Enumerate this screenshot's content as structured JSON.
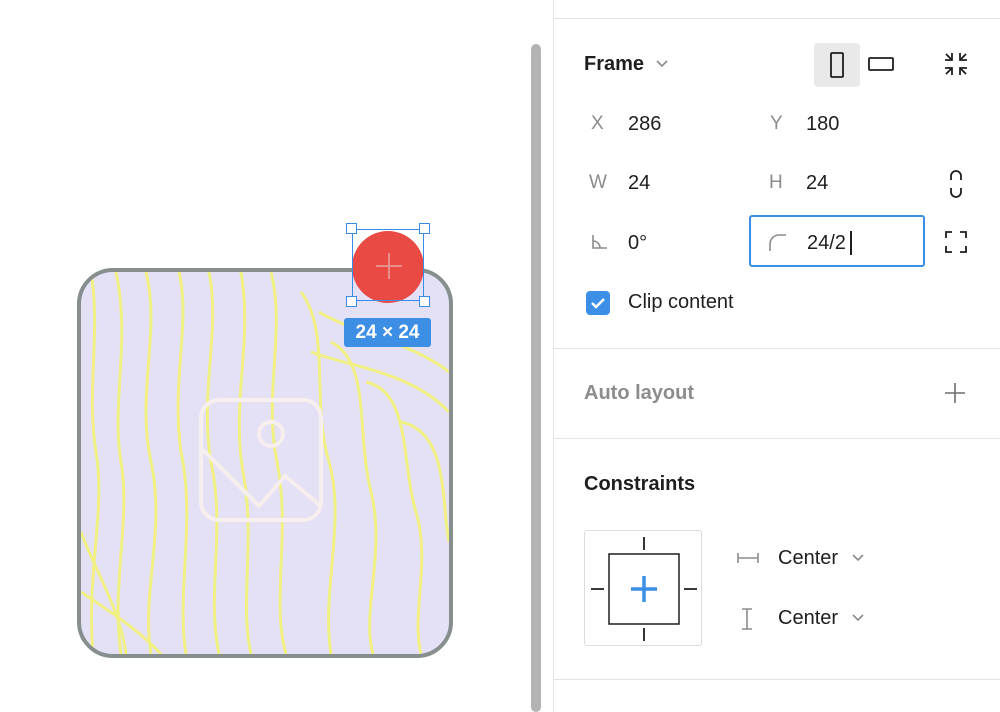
{
  "canvas": {
    "selection_size_label": "24 × 24",
    "colors": {
      "card_fill": "#e4e0f6",
      "card_stroke": "#868f8e",
      "topo_lines": "#f1f082",
      "ellipse": "#ea4a44",
      "selection": "#3a8de6"
    }
  },
  "panel": {
    "frame": {
      "title": "Frame",
      "x_label": "X",
      "x_value": "286",
      "y_label": "Y",
      "y_value": "180",
      "w_label": "W",
      "w_value": "24",
      "h_label": "H",
      "h_value": "24",
      "rotation_value": "0°",
      "radius_value": "24/2",
      "clip_label": "Clip content",
      "clip_checked": true
    },
    "auto_layout": {
      "title": "Auto layout"
    },
    "constraints": {
      "title": "Constraints",
      "horizontal": "Center",
      "vertical": "Center"
    }
  }
}
